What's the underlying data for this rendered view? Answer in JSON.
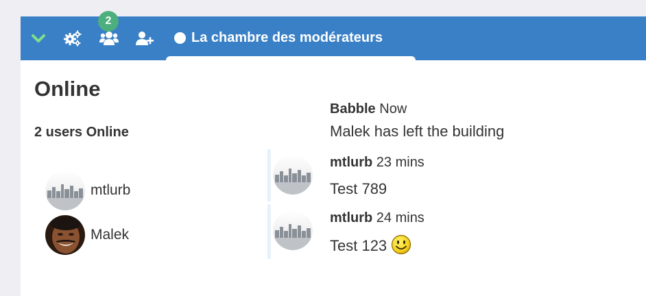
{
  "toolbar": {
    "notification_count": "2",
    "room_name": "La chambre des modérateurs",
    "icons": [
      "chevron-down-icon",
      "cogs-icon",
      "users-icon",
      "add-user-icon"
    ],
    "accent": "#3a80c6",
    "badge_color": "#4caf7d",
    "chevron_color": "#7ee08a"
  },
  "sidebar": {
    "title": "Online",
    "count_label": "2 users Online",
    "users": [
      {
        "name": "mtlurb",
        "avatar": "skyline-avatar"
      },
      {
        "name": "Malek",
        "avatar": "person-avatar"
      }
    ]
  },
  "messages": [
    {
      "author": "Babble",
      "time": "Now",
      "text": "Malek has left the building"
    },
    {
      "author": "mtlurb",
      "time": "23 mins",
      "text": "Test 789"
    },
    {
      "author": "mtlurb",
      "time": "24 mins",
      "text": "Test 123",
      "emoji": "smiley-icon"
    }
  ]
}
